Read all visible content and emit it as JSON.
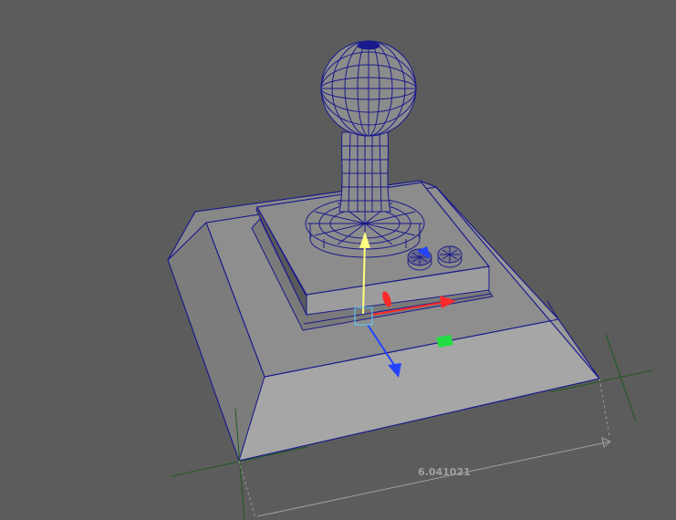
{
  "viewport": {
    "background_color": "#5c5c5c",
    "wireframe_color": "#1a1a8c",
    "surface_color": "#8e8e8e",
    "locator_color": "#1e5a1e"
  },
  "scene": {
    "object": "joystick-model",
    "parts": [
      "base-bevel",
      "base-plate",
      "stick-shaft",
      "stick-ball",
      "button-left",
      "button-right"
    ]
  },
  "manipulator": {
    "type": "move-rotate",
    "axis_colors": {
      "x": "#ff2a2a",
      "y": "#ffff80",
      "z": "#2244ff",
      "plane": "#22dd44",
      "center": "#5ad0ff"
    }
  },
  "distance_tool": {
    "value": "6.041021",
    "color": "#a0a0a0"
  }
}
